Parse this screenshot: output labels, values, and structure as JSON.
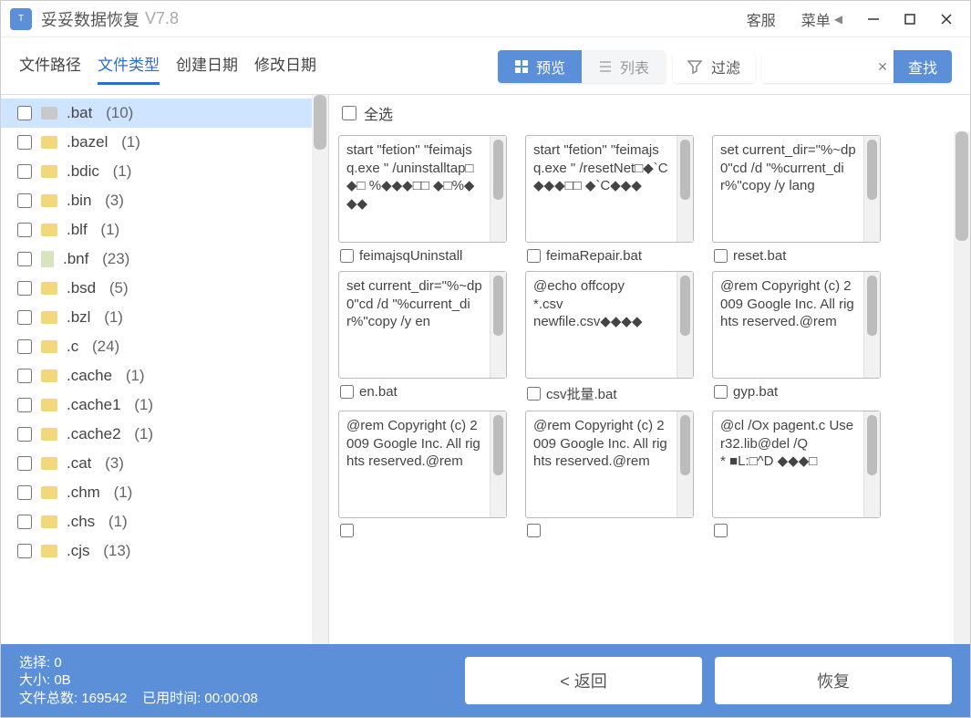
{
  "title": "妥妥数据恢复",
  "version": "V7.8",
  "titlebar": {
    "support": "客服",
    "menu": "菜单"
  },
  "tabs": {
    "path": "文件路径",
    "type": "文件类型",
    "created": "创建日期",
    "modified": "修改日期",
    "active": "type"
  },
  "toolbar": {
    "preview": "预览",
    "list": "列表",
    "filter": "过滤",
    "search": {
      "placeholder": "",
      "go": "查找"
    }
  },
  "sidebar": {
    "items": [
      {
        "ext": ".bat",
        "count": 10,
        "selected": true,
        "folder": "gray"
      },
      {
        "ext": ".bazel",
        "count": 1
      },
      {
        "ext": ".bdic",
        "count": 1
      },
      {
        "ext": ".bin",
        "count": 3
      },
      {
        "ext": ".blf",
        "count": 1
      },
      {
        "ext": ".bnf",
        "count": 23,
        "folder": "file"
      },
      {
        "ext": ".bsd",
        "count": 5
      },
      {
        "ext": ".bzl",
        "count": 1
      },
      {
        "ext": ".c",
        "count": 24
      },
      {
        "ext": ".cache",
        "count": 1
      },
      {
        "ext": ".cache1",
        "count": 1
      },
      {
        "ext": ".cache2",
        "count": 1
      },
      {
        "ext": ".cat",
        "count": 3
      },
      {
        "ext": ".chm",
        "count": 1
      },
      {
        "ext": ".chs",
        "count": 1
      },
      {
        "ext": ".cjs",
        "count": 13
      }
    ]
  },
  "main": {
    "selectall": "全选",
    "files": [
      {
        "name": "feimajsqUninstall",
        "preview": "start \"fetion\" \"feimajsq.exe \" /uninstalltap□◆□ %◆◆◆□□ ◆□%◆◆◆"
      },
      {
        "name": "feimaRepair.bat",
        "preview": "start \"fetion\" \"feimajsq.exe \" /resetNet□◆`C◆◆◆□□        ◆`C◆◆◆"
      },
      {
        "name": "reset.bat",
        "preview": "set current_dir=\"%~dp0\"cd /d \"%current_dir%\"copy /y lang"
      },
      {
        "name": "en.bat",
        "preview": "set current_dir=\"%~dp0\"cd /d \"%current_dir%\"copy /y en"
      },
      {
        "name": "csv批量.bat",
        "preview": "@echo offcopy\n*.csv\nnewfile.csv◆◆◆◆"
      },
      {
        "name": "gyp.bat",
        "preview": "@rem Copyright (c) 2009 Google Inc. All rights reserved.@rem"
      },
      {
        "name": "",
        "preview": "@rem Copyright (c) 2009 Google Inc. All rights reserved.@rem"
      },
      {
        "name": "",
        "preview": "@rem Copyright (c) 2009 Google Inc. All rights reserved.@rem"
      },
      {
        "name": "",
        "preview": "@cl /Ox pagent.c User32.lib@del /Q\n* ■L:□^D ◆◆◆□"
      }
    ]
  },
  "footer": {
    "select_label": "选择:",
    "select_value": "0",
    "size_label": "大小:",
    "size_value": "0B",
    "total_label": "文件总数:",
    "total_value": "169542",
    "elapsed_label": "已用时间:",
    "elapsed_value": "00:00:08",
    "back": "< 返回",
    "recover": "恢复"
  }
}
